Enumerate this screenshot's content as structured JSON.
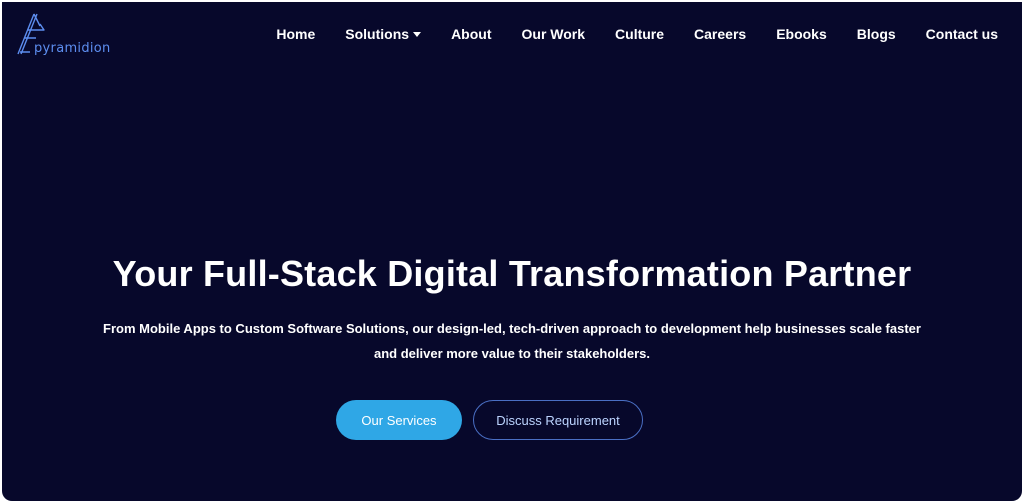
{
  "brand": {
    "name": "pyramidion",
    "accent": "#5d8ef0"
  },
  "nav": {
    "items": [
      {
        "label": "Home"
      },
      {
        "label": "Solutions",
        "dropdown": true
      },
      {
        "label": "About"
      },
      {
        "label": "Our Work"
      },
      {
        "label": "Culture"
      },
      {
        "label": "Careers"
      },
      {
        "label": "Ebooks"
      },
      {
        "label": "Blogs"
      },
      {
        "label": "Contact us"
      }
    ]
  },
  "hero": {
    "title": "Your Full-Stack Digital Transformation Partner",
    "subtitle_line1": "From Mobile Apps to Custom Software Solutions, our design-led, tech-driven approach to development help businesses scale faster",
    "subtitle_line2": "and deliver more value to their stakeholders.",
    "primary_button": "Our Services",
    "secondary_button": "Discuss Requirement"
  },
  "colors": {
    "background": "#07082b",
    "primary_button": "#2fa7e6",
    "outline_border": "#4a6fc4"
  },
  "icons": {
    "logo": "pyramid-logo-icon",
    "dropdown": "caret-down-icon"
  }
}
